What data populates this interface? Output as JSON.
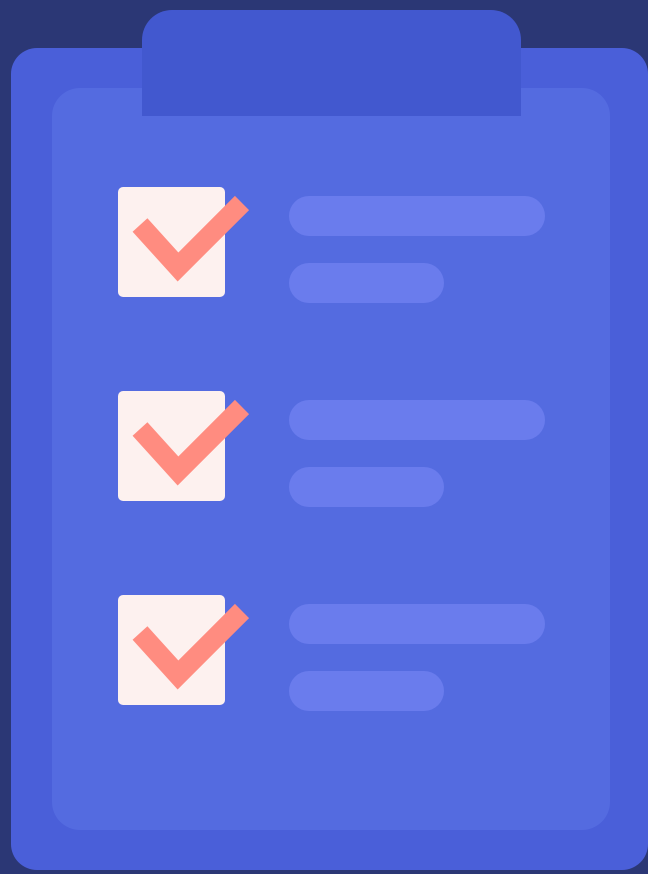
{
  "colors": {
    "background": "#2b3775",
    "board": "#4a5fd9",
    "sheet": "#546be0",
    "clip": "#4258cf",
    "checkbox": "#fdf1ef",
    "check": "#ff8c80",
    "text_placeholder": "#6a7ced"
  },
  "illustration": {
    "icon": "clipboard-checklist-icon",
    "items": [
      {
        "checked": true
      },
      {
        "checked": true
      },
      {
        "checked": true
      }
    ]
  }
}
